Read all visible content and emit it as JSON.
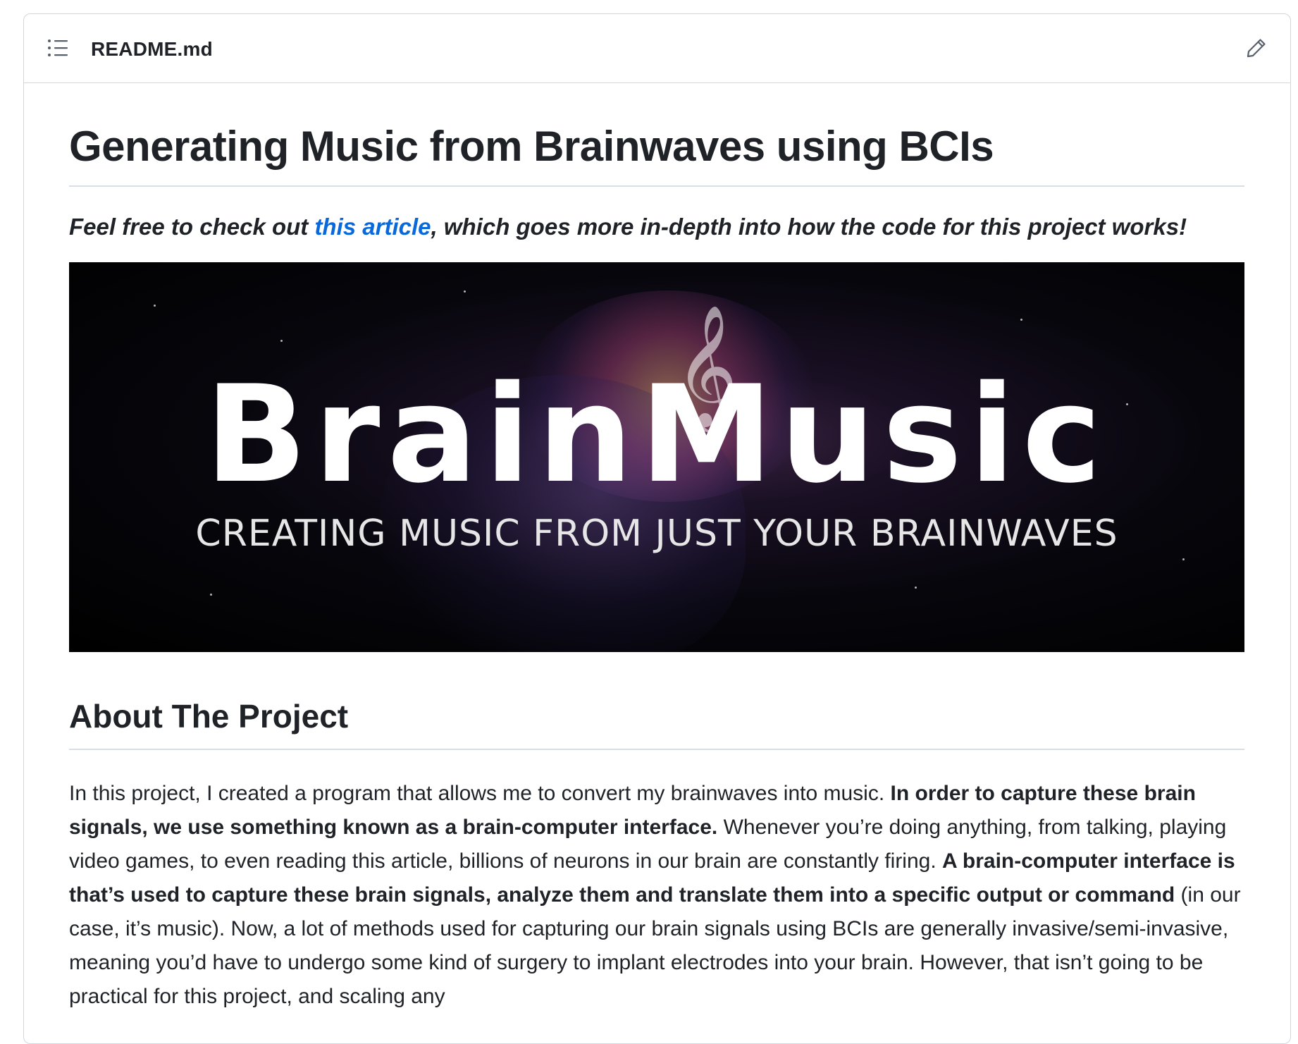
{
  "readme": {
    "file_name": "README.md",
    "toc_icon": "list-unordered-icon",
    "edit_icon": "pencil-icon"
  },
  "article": {
    "title": "Generating Music from Brainwaves using BCIs",
    "intro_before": "Feel free to check out ",
    "intro_link": "this article",
    "intro_after": ", which goes more in-depth into how the code for this project works!",
    "banner": {
      "title": "BrainMusic",
      "subtitle": "CREATING MUSIC FROM JUST YOUR BRAINWAVES"
    },
    "section_heading": "About The Project",
    "paragraph": [
      {
        "text": "In this project, I created a program that allows me to convert my brainwaves into music. ",
        "bold": false
      },
      {
        "text": "In order to capture these brain signals, we use something known as a brain-computer interface.",
        "bold": true
      },
      {
        "text": " Whenever you’re doing anything, from talking, playing video games, to even reading this article, billions of neurons in our brain are constantly firing. ",
        "bold": false
      },
      {
        "text": "A brain-computer interface is that’s used to capture these brain signals, analyze them and translate them into a specific output or command",
        "bold": true
      },
      {
        "text": " (in our case, it’s music). Now, a lot of methods used for capturing our brain signals using BCIs are generally invasive/semi-invasive, meaning you’d have to undergo some kind of surgery to implant electrodes into your brain. However, that isn’t going to be practical for this project, and scaling any",
        "bold": false
      }
    ]
  },
  "colors": {
    "link": "#0969da",
    "text": "#1f2328",
    "border": "#d0d7de"
  }
}
